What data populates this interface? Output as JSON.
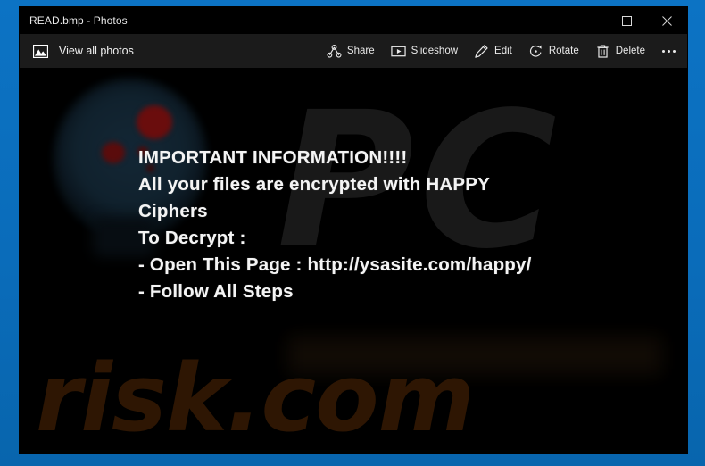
{
  "window": {
    "title": "READ.bmp - Photos",
    "controls": [
      {
        "name": "minimize",
        "glyph": "minimize-icon"
      },
      {
        "name": "maximize",
        "glyph": "maximize-icon"
      },
      {
        "name": "close",
        "glyph": "close-icon"
      }
    ]
  },
  "commandbar": {
    "view_all_label": "View all photos",
    "view_all_icon": "photo-icon",
    "tools": [
      {
        "label": "Share",
        "icon": "share-icon"
      },
      {
        "label": "Slideshow",
        "icon": "slideshow-icon"
      },
      {
        "label": "Edit",
        "icon": "pencil-edit-icon"
      },
      {
        "label": "Rotate",
        "icon": "rotate-icon"
      },
      {
        "label": "Delete",
        "icon": "trash-delete-icon"
      }
    ],
    "more_icon": "ellipsis-more-icon"
  },
  "image": {
    "watermark_logo": "PC",
    "watermark_site": "risk.com",
    "note_lines": [
      "IMPORTANT INFORMATION!!!!",
      "All your files are encrypted with HAPPY",
      "Ciphers",
      "To Decrypt :",
      "- Open This Page : http://ysasite.com/happy/",
      "- Follow All Steps"
    ]
  },
  "colors": {
    "desktop_accent": "#0a6cba",
    "window_background": "#000000",
    "commandbar_background": "#1b1b1b",
    "text_primary": "#f4f4f4",
    "watermark_logo_color": "#191919",
    "watermark_site_color": "#2e1603"
  }
}
